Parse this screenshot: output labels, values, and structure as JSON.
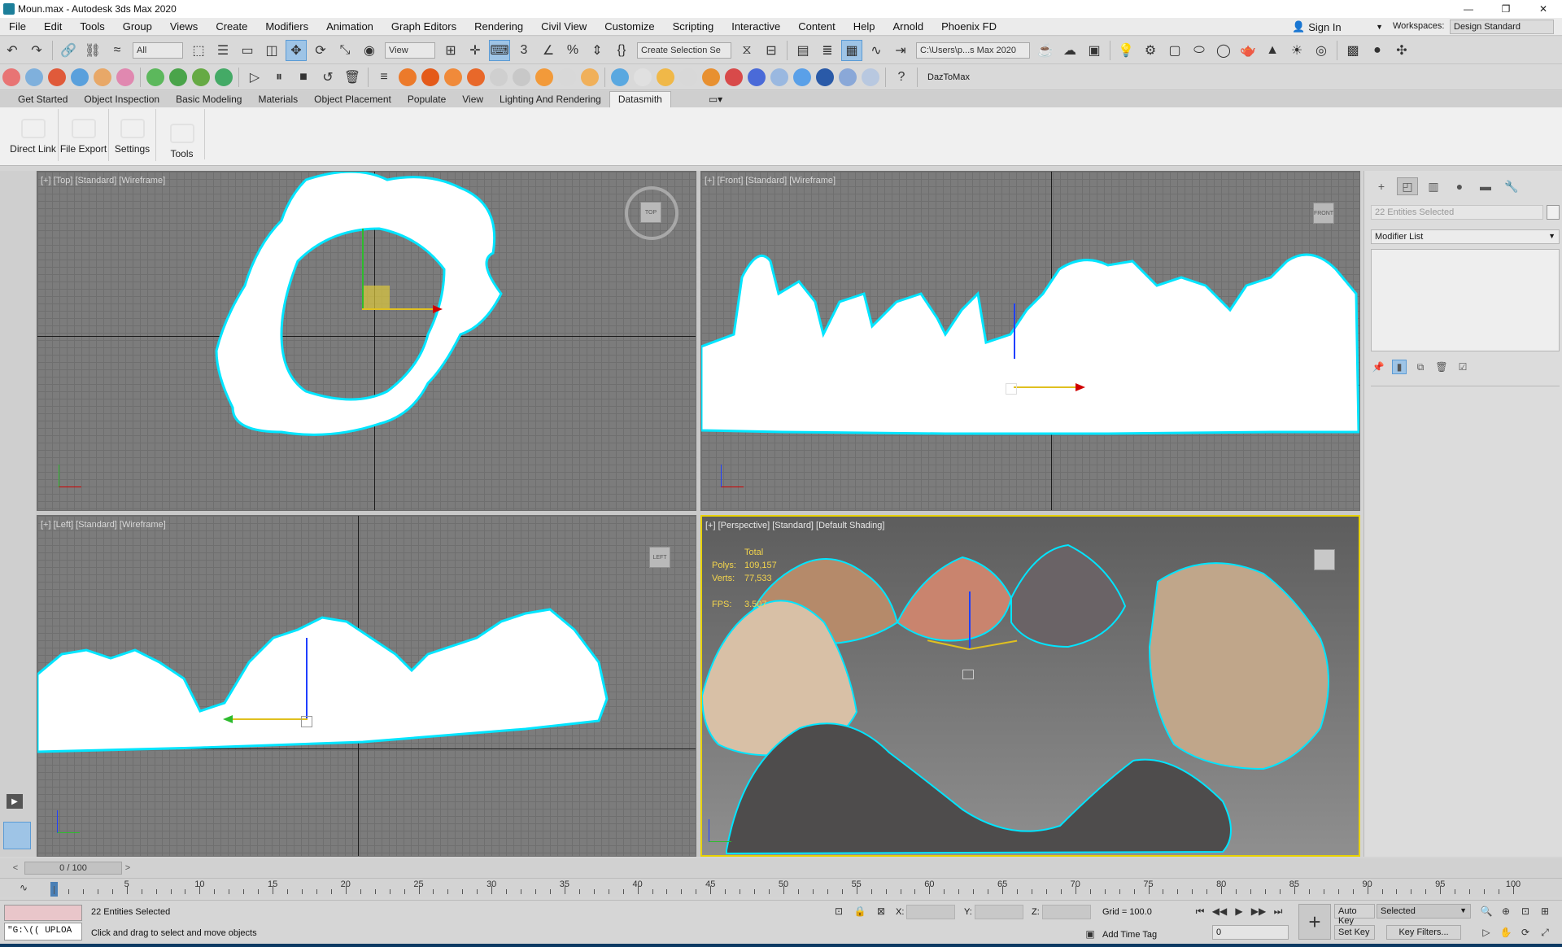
{
  "window": {
    "title": "Moun.max - Autodesk 3ds Max 2020",
    "controls": [
      "—",
      "❐",
      "✕"
    ]
  },
  "menu": [
    "File",
    "Edit",
    "Tools",
    "Group",
    "Views",
    "Create",
    "Modifiers",
    "Animation",
    "Graph Editors",
    "Rendering",
    "Civil View",
    "Customize",
    "Scripting",
    "Interactive",
    "Content",
    "Help",
    "Arnold",
    "Phoenix FD"
  ],
  "account": {
    "sign_in": "Sign In",
    "workspaces_label": "Workspaces:",
    "workspace": "Design Standard"
  },
  "toolbar1": {
    "filter": "All",
    "ref_coord": "View",
    "named_selection": "Create Selection Se",
    "project_path": "C:\\Users\\p...s Max 2020"
  },
  "toolbar2": {
    "plugin": "DazToMax"
  },
  "ribbon": {
    "tabs": [
      "Get Started",
      "Object Inspection",
      "Basic Modeling",
      "Materials",
      "Object Placement",
      "Populate",
      "View",
      "Lighting And Rendering",
      "Datasmith"
    ],
    "active_tab": "Datasmith",
    "buttons": [
      "Direct Link",
      "File Export",
      "Settings",
      "Tools"
    ]
  },
  "viewports": {
    "top": {
      "label": "[+] [Top] [Standard] [Wireframe]",
      "cube": "TOP"
    },
    "front": {
      "label": "[+] [Front] [Standard] [Wireframe]",
      "cube": "FRONT"
    },
    "left": {
      "label": "[+] [Left] [Standard] [Wireframe]",
      "cube": "LEFT"
    },
    "perspective": {
      "label": "[+] [Perspective] [Standard] [Default Shading]",
      "stats": {
        "header": "Total",
        "polys_label": "Polys:",
        "polys": "109,157",
        "verts_label": "Verts:",
        "verts": "77,533",
        "fps_label": "FPS:",
        "fps": "3.507"
      }
    }
  },
  "command_panel": {
    "selection": "22 Entities Selected",
    "modifier_list": "Modifier List"
  },
  "time": {
    "frame": "0 / 100",
    "prev": "<",
    "next": ">",
    "ticks": [
      5,
      10,
      15,
      20,
      25,
      30,
      35,
      40,
      45,
      50,
      55,
      60,
      65,
      70,
      75,
      80,
      85,
      90,
      95,
      100
    ]
  },
  "status": {
    "selected": "22 Entities Selected",
    "prompt": "Click and drag to select and move objects",
    "listener": "\"G:\\(( UPLOA",
    "x_label": "X:",
    "y_label": "Y:",
    "z_label": "Z:",
    "grid": "Grid = 100.0",
    "add_time_tag": "Add Time Tag",
    "auto_key": "Auto Key",
    "key_mode": "Selected",
    "set_key": "Set Key",
    "key_filters": "Key Filters...",
    "current_frame": "0"
  },
  "colors": {
    "selection_outline": "#00e5ff",
    "active_border": "#e8d200",
    "axis_x": "#d00000",
    "axis_y": "#2dbb2d",
    "axis_z": "#2040ff"
  }
}
